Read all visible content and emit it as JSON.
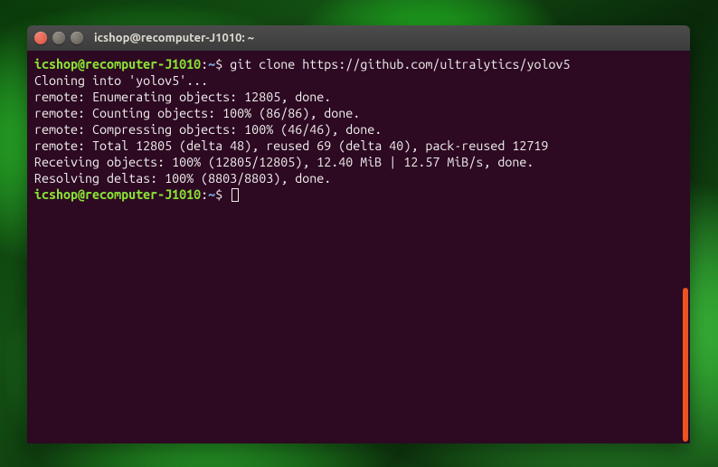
{
  "titlebar": {
    "title": "icshop@recomputer-J1010: ~"
  },
  "prompt": {
    "user_host": "icshop@recomputer-J1010",
    "colon": ":",
    "path": "~",
    "dollar": "$"
  },
  "command1": " git clone https://github.com/ultralytics/yolov5",
  "output": {
    "l1": "Cloning into 'yolov5'...",
    "l2": "remote: Enumerating objects: 12805, done.",
    "l3": "remote: Counting objects: 100% (86/86), done.",
    "l4": "remote: Compressing objects: 100% (46/46), done.",
    "l5": "remote: Total 12805 (delta 48), reused 69 (delta 40), pack-reused 12719",
    "l6": "Receiving objects: 100% (12805/12805), 12.40 MiB | 12.57 MiB/s, done.",
    "l7": "Resolving deltas: 100% (8803/8803), done."
  },
  "command2": " "
}
